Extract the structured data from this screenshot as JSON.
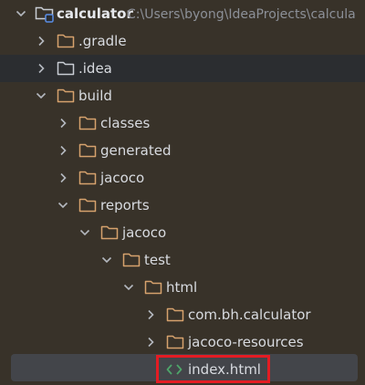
{
  "colors": {
    "folder": "#d6a26d",
    "module_folder": "#8fa6c9",
    "excluded_folder": "#c9cdd4",
    "html_icon": "#4ea56a",
    "highlight_border": "#e31c23",
    "selection": "#43454a"
  },
  "tree": {
    "root": {
      "label": "calculator",
      "path": "C:\\Users\\byong\\IdeaProjects\\calcula",
      "icon": "module-folder-icon",
      "expanded": true
    },
    "nodes": [
      {
        "label": ".gradle",
        "icon": "folder-icon",
        "expanded": false
      },
      {
        "label": ".idea",
        "icon": "folder-icon",
        "expanded": false
      },
      {
        "label": "build",
        "icon": "folder-icon",
        "expanded": true
      },
      {
        "label": "classes",
        "icon": "folder-icon",
        "expanded": false
      },
      {
        "label": "generated",
        "icon": "folder-icon",
        "expanded": false
      },
      {
        "label": "jacoco",
        "icon": "folder-icon",
        "expanded": false
      },
      {
        "label": "reports",
        "icon": "folder-icon",
        "expanded": true
      },
      {
        "label": "jacoco",
        "icon": "folder-icon",
        "expanded": true
      },
      {
        "label": "test",
        "icon": "folder-icon",
        "expanded": true
      },
      {
        "label": "html",
        "icon": "folder-icon",
        "expanded": true
      },
      {
        "label": "com.bh.calculator",
        "icon": "folder-icon",
        "expanded": false
      },
      {
        "label": "jacoco-resources",
        "icon": "folder-icon",
        "expanded": false
      },
      {
        "label": "index.html",
        "icon": "html-file-icon",
        "selected": true
      }
    ]
  }
}
